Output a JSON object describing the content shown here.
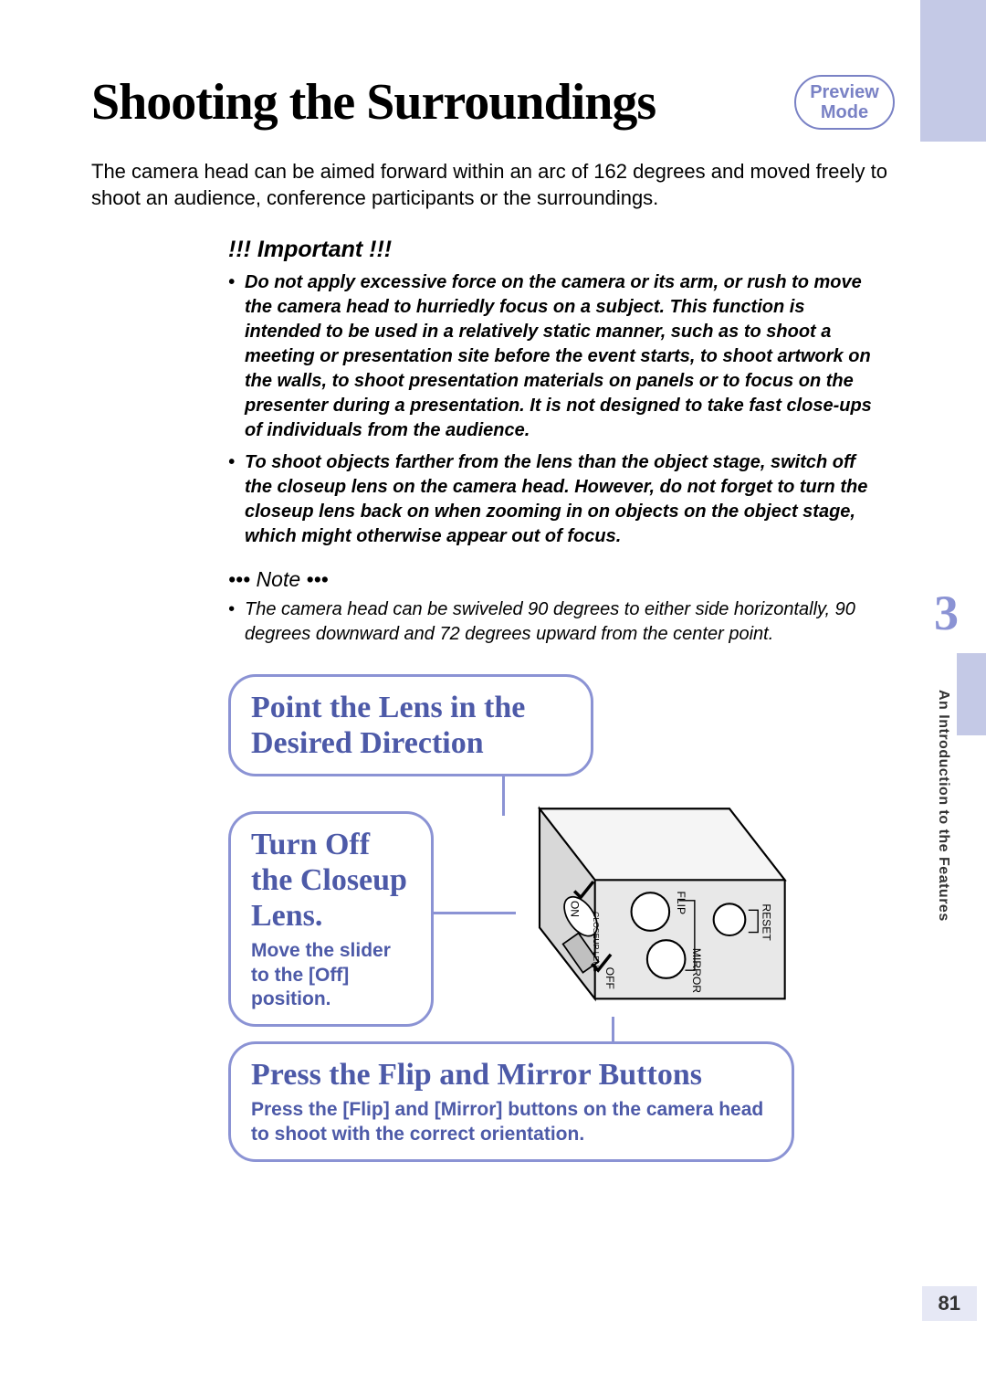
{
  "header": {
    "title": "Shooting the Surroundings",
    "mode_badge": "Preview\nMode"
  },
  "intro": "The camera head can be aimed forward within an arc of 162 degrees and moved freely to shoot an audience, conference participants or the surroundings.",
  "important": {
    "heading": "!!! Important !!!",
    "items": [
      "Do not apply excessive force on the camera or its arm, or rush to move the camera head to hurriedly focus on a subject. This function is intended to be used in a relatively static manner, such as to shoot a meeting or presentation site before the event starts, to shoot artwork on the walls, to shoot presentation materials on panels or to focus on the presenter during a presentation. It is not designed to take fast close-ups of individuals from the audience.",
      "To shoot objects farther from the lens than the object stage, switch off the closeup lens on the camera head. However, do not forget to turn the closeup lens back on when zooming in on objects on the object stage, which might otherwise appear out of focus."
    ]
  },
  "note": {
    "heading": "••• Note •••",
    "items": [
      "The camera head can be swiveled 90 degrees to either side horizontally, 90 degrees downward and 72 degrees upward from the center point."
    ]
  },
  "steps": {
    "box1_title": "Point the Lens in the Desired Direction",
    "box2_title": "Turn Off the Closeup Lens.",
    "box2_sub": "Move the slider to the [Off] position.",
    "box3_title": "Press the Flip and Mirror Buttons",
    "box3_sub": "Press the [Flip] and [Mirror] buttons on the camera head to shoot with the correct orientation."
  },
  "device_labels": {
    "on": "ON",
    "off": "OFF",
    "closeup_lens": "CLOSEUP LENS",
    "flip": "FLIP",
    "mirror": "MIRROR",
    "reset": "RESET"
  },
  "chapter": {
    "number": "3",
    "side_label": "An Introduction to the Features"
  },
  "page_number": "81",
  "colors": {
    "accent": "#8b93d4",
    "accent_text": "#4d5aa8",
    "light_accent": "#c4c9e6"
  }
}
